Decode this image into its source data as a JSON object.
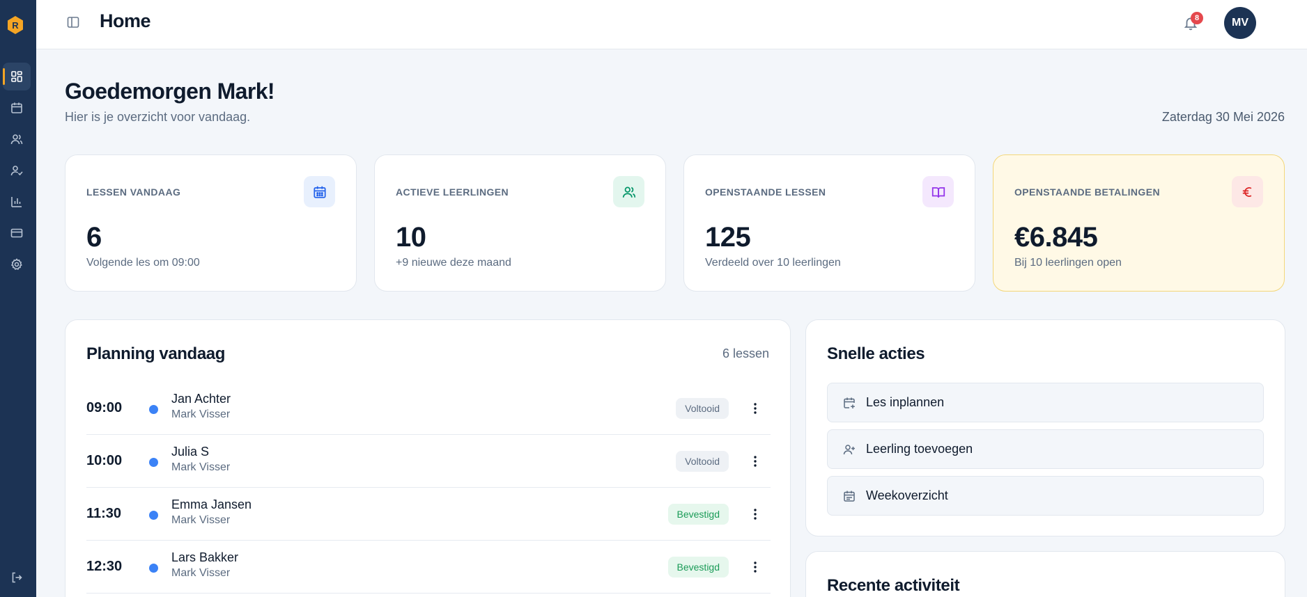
{
  "sidebar": {
    "logo_letter": "R",
    "items": [
      {
        "icon": "dashboard-icon",
        "active": true
      },
      {
        "icon": "calendar-icon"
      },
      {
        "icon": "users-icon"
      },
      {
        "icon": "user-check-icon"
      },
      {
        "icon": "bar-chart-icon"
      },
      {
        "icon": "credit-card-icon"
      },
      {
        "icon": "settings-icon"
      }
    ],
    "logout_icon": "logout-icon"
  },
  "header": {
    "title": "Home",
    "notification_count": "8",
    "avatar_initials": "MV"
  },
  "greeting": {
    "title": "Goedemorgen Mark!",
    "subtitle": "Hier is je overzicht voor vandaag.",
    "date": "Zaterdag 30 Mei 2026"
  },
  "stats": [
    {
      "label": "LESSEN VANDAAG",
      "value": "6",
      "note": "Volgende les om 09:00",
      "icon": "calendar-icon",
      "color": "#2563eb"
    },
    {
      "label": "ACTIEVE LEERLINGEN",
      "value": "10",
      "note": "+9 nieuwe deze maand",
      "icon": "users-icon",
      "color": "#059669"
    },
    {
      "label": "OPENSTAANDE LESSEN",
      "value": "125",
      "note": "Verdeeld over 10 leerlingen",
      "icon": "book-icon",
      "color": "#9333ea"
    },
    {
      "label": "OPENSTAANDE BETALINGEN",
      "value": "€6.845",
      "note": "Bij 10 leerlingen open",
      "icon": "euro-icon",
      "color": "#dc2626"
    }
  ],
  "planning": {
    "title": "Planning vandaag",
    "count": "6 lessen",
    "lessons": [
      {
        "time": "09:00",
        "student": "Jan Achter",
        "teacher": "Mark Visser",
        "status": "Voltooid"
      },
      {
        "time": "10:00",
        "student": "Julia S",
        "teacher": "Mark Visser",
        "status": "Voltooid"
      },
      {
        "time": "11:30",
        "student": "Emma Jansen",
        "teacher": "Mark Visser",
        "status": "Bevestigd"
      },
      {
        "time": "12:30",
        "student": "Lars Bakker",
        "teacher": "Mark Visser",
        "status": "Bevestigd"
      }
    ]
  },
  "quick_actions": {
    "title": "Snelle acties",
    "items": [
      {
        "label": "Les inplannen",
        "icon": "calendar-plus-icon"
      },
      {
        "label": "Leerling toevoegen",
        "icon": "user-plus-icon"
      },
      {
        "label": "Weekoverzicht",
        "icon": "calendar-week-icon"
      }
    ]
  },
  "recent_activity": {
    "title": "Recente activiteit"
  },
  "colors": {
    "sidebar": "#1c3354",
    "accent": "#f5a524",
    "status_done_bg": "#eef1f5",
    "status_confirmed_bg": "#e6f7ed",
    "status_confirmed_text": "#1a9b57",
    "dot": "#3b82f6"
  }
}
